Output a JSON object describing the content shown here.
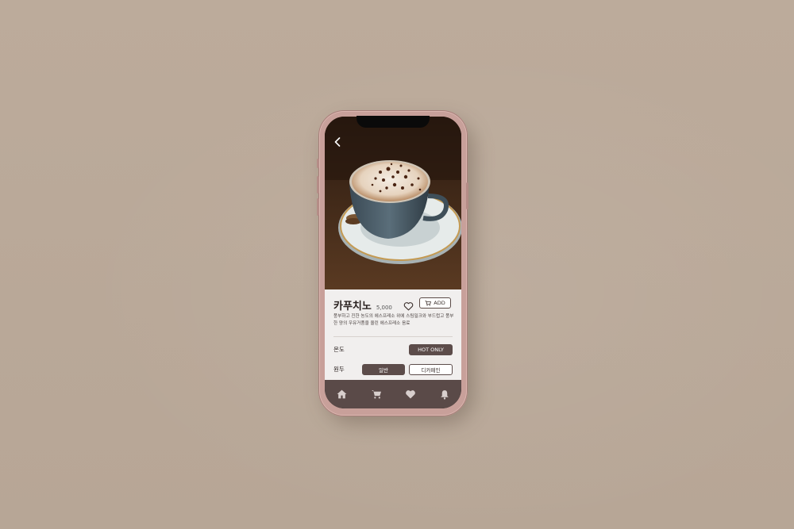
{
  "product": {
    "name": "카푸치노",
    "price": "5,000",
    "description": "풍부하고 진한 농도의 에스프레소 위에 스팀밀크와 부드럽고 풍부한 양의 우유거품을 올린 에스프레소 음료",
    "favorite_icon": "heart-outline-icon",
    "add_label": "ADD",
    "add_icon": "cart-icon"
  },
  "options": {
    "temperature": {
      "label": "온도",
      "value": "HOT ONLY"
    },
    "beans": {
      "label": "원두",
      "choices": [
        "일반",
        "디카페인"
      ],
      "selected": "일반"
    }
  },
  "nav": {
    "back_icon": "chevron-left-icon",
    "tabs": [
      "home-icon",
      "cart-icon",
      "heart-icon",
      "bell-icon"
    ]
  },
  "colors": {
    "accent": "#5c4c4a",
    "tabbar": "#5a4a48",
    "phone_frame": "#c8a09a",
    "background": "#b8a898"
  }
}
